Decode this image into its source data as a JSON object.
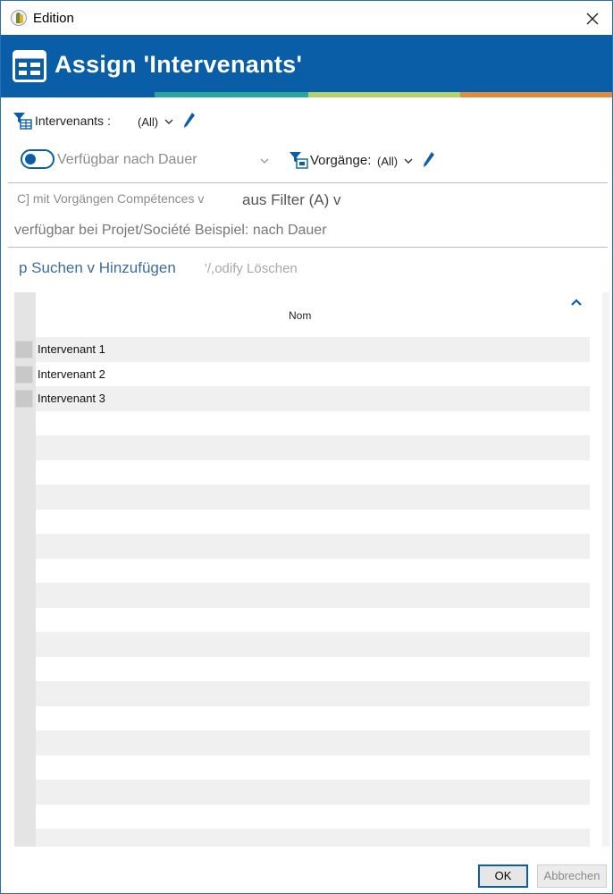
{
  "window": {
    "title": "Edition",
    "close_icon": "close-icon"
  },
  "banner": {
    "title": "Assign 'Intervenants'",
    "icon": "grid-form-icon",
    "stripe_colors": [
      "#0a5ea8",
      "#2aa59a",
      "#b5d06a",
      "#e08c3c"
    ]
  },
  "filters": {
    "intervenants_label": "Intervenants :",
    "intervenants_value": "(All)",
    "availability_label": "Verfügbar nach Dauer",
    "vorgaenge_label": "Vorgänge:",
    "vorgaenge_value": "(All)"
  },
  "options": {
    "line1_left": "C] mit Vorgängen Compétences v",
    "line1_right": "aus Filter (A) v",
    "line2": "verfügbar bei Projet/Société Beispiel: nach Dauer"
  },
  "actions": {
    "search_add": "p Suchen v Hinzufügen",
    "modify_delete": "'/,odify Löschen"
  },
  "grid": {
    "column_header": "Nom",
    "rows": [
      "Intervenant 1",
      "Intervenant 2",
      "Intervenant 3"
    ]
  },
  "buttons": {
    "ok": "OK",
    "cancel": "Abbrechen"
  },
  "colors": {
    "accent": "#0a5ea8"
  }
}
